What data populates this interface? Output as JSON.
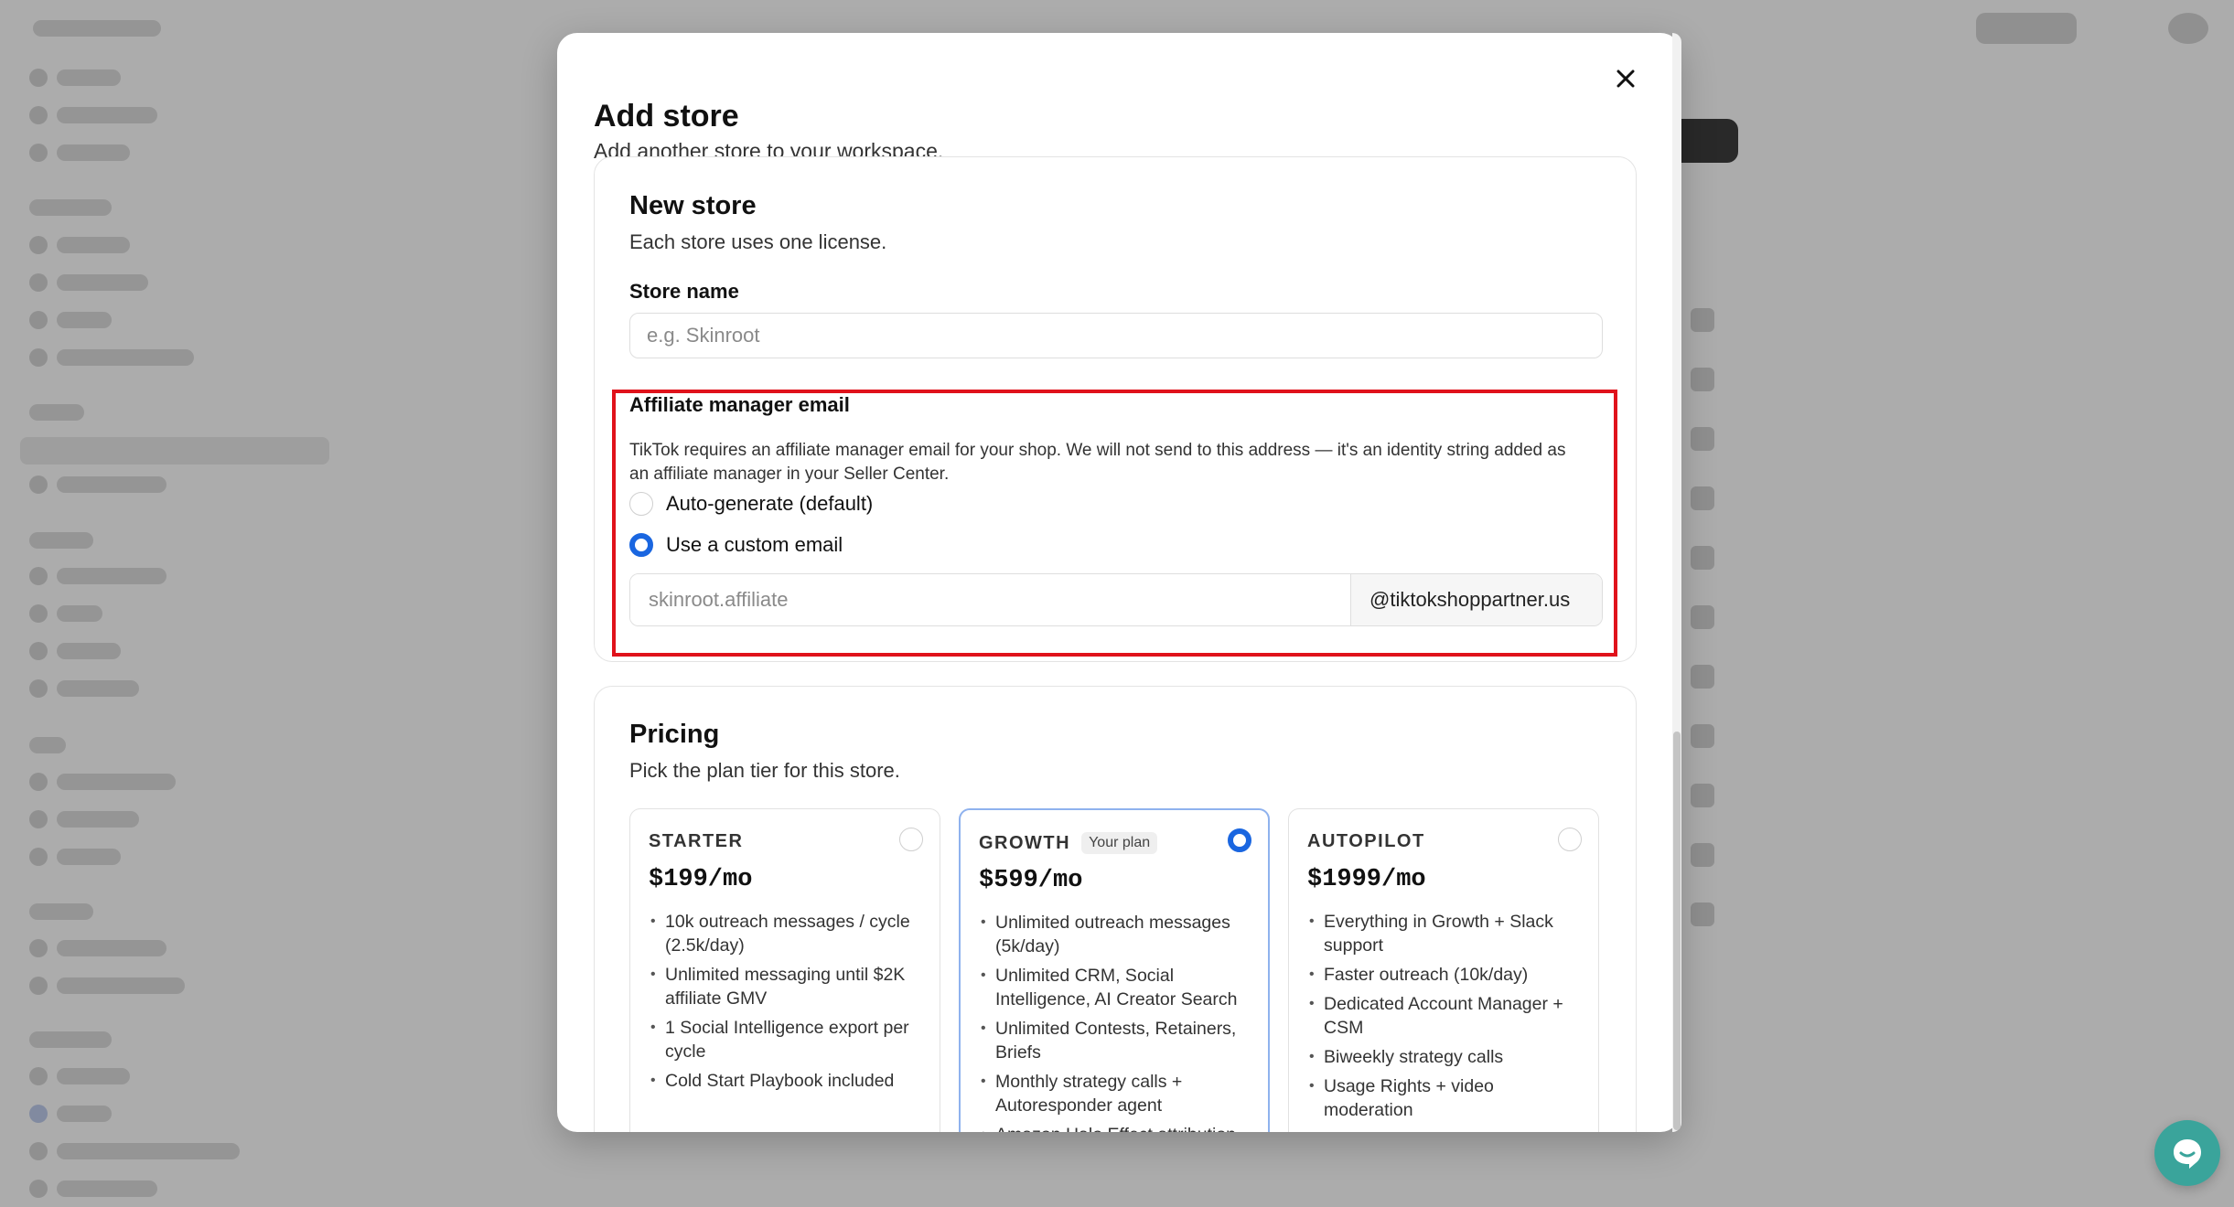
{
  "modal": {
    "title": "Add store",
    "subtitle": "Add another store to your workspace."
  },
  "new_store": {
    "title": "New store",
    "subtitle": "Each store uses one license.",
    "store_name_label": "Store name",
    "store_name_placeholder": "e.g. Skinroot",
    "store_name_value": ""
  },
  "affiliate": {
    "label": "Affiliate manager email",
    "help": "TikTok requires an affiliate manager email for your shop. We will not send to this address — it's an identity string added as an affiliate manager in your Seller Center.",
    "options": [
      {
        "label": "Auto-generate (default)",
        "selected": false
      },
      {
        "label": "Use a custom email",
        "selected": true
      }
    ],
    "email_placeholder": "skinroot.affiliate",
    "email_value": "",
    "email_suffix": "@tiktokshoppartner.us"
  },
  "pricing": {
    "title": "Pricing",
    "subtitle": "Pick the plan tier for this store.",
    "tiers": [
      {
        "name": "STARTER",
        "badge": "",
        "price": "$199/mo",
        "selected": false,
        "features": [
          "10k outreach messages / cycle (2.5k/day)",
          "Unlimited messaging until $2K affiliate GMV",
          "1 Social Intelligence export per cycle",
          "Cold Start Playbook included"
        ]
      },
      {
        "name": "GROWTH",
        "badge": "Your plan",
        "price": "$599/mo",
        "selected": true,
        "features": [
          "Unlimited outreach messages (5k/day)",
          "Unlimited CRM, Social Intelligence, AI Creator Search",
          "Unlimited Contests, Retainers, Briefs",
          "Monthly strategy calls + Autoresponder agent",
          "Amazon Halo Effect attribution"
        ]
      },
      {
        "name": "AUTOPILOT",
        "badge": "",
        "price": "$1999/mo",
        "selected": false,
        "features": [
          "Everything in Growth + Slack support",
          "Faster outreach (10k/day)",
          "Dedicated Account Manager + CSM",
          "Biweekly strategy calls",
          "Usage Rights + video moderation"
        ]
      }
    ]
  },
  "colors": {
    "accent": "#1a66e0",
    "highlight": "#e0121b",
    "chat": "#3aa49b"
  },
  "icons": {
    "close": "close-icon",
    "chat": "chat-icon"
  }
}
